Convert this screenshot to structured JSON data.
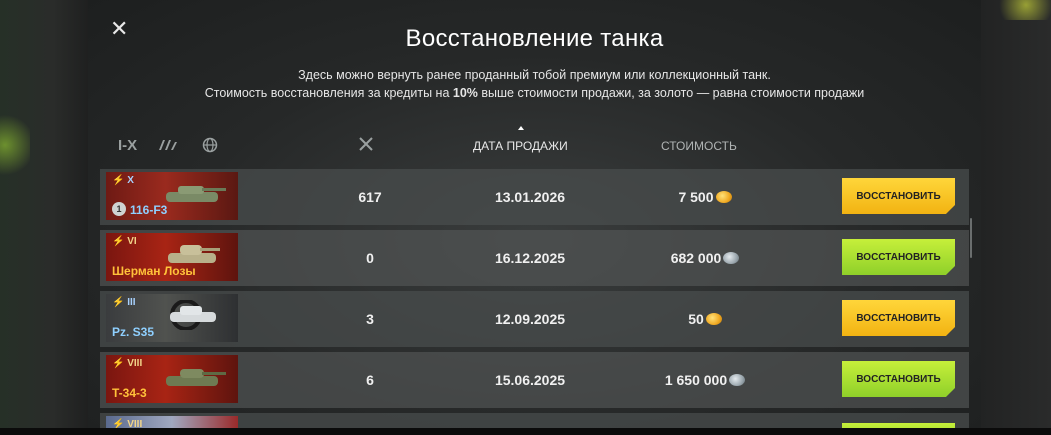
{
  "dialog": {
    "close_icon": "close-icon",
    "title": "Восстановление танка",
    "subtitle_line1": "Здесь можно вернуть ранее проданный тобой премиум или коллекционный танк.",
    "subtitle_line2_pre": "Стоимость восстановления за кредиты на ",
    "subtitle_line2_bold": "10%",
    "subtitle_line2_post": " выше стоимости продажи, за золото — равна стоимости продажи"
  },
  "filters": {
    "tier_label": "I-X",
    "type_icon": "tank-type-filter-icon",
    "nation_icon": "globe-icon"
  },
  "columns": {
    "battles_icon": "crossed-swords-icon",
    "date": "ДАТА ПРОДАЖИ",
    "cost": "СТОИМОСТЬ"
  },
  "colors": {
    "gold_button": "#f2b312",
    "green_button": "#8fd02a",
    "panel_bg": "#262828"
  },
  "rows": [
    {
      "tier": "X",
      "name": "116-F3",
      "battles": "617",
      "date": "13.01.2026",
      "cost": "7 500",
      "currency": "gold",
      "button": "ВОССТАНОВИТЬ"
    },
    {
      "tier": "VI",
      "name": "Шерман Лозы",
      "battles": "0",
      "date": "16.12.2025",
      "cost": "682 000",
      "currency": "silver",
      "button": "ВОССТАНОВИТЬ"
    },
    {
      "tier": "III",
      "name": "Pz. S35",
      "battles": "3",
      "date": "12.09.2025",
      "cost": "50",
      "currency": "gold",
      "button": "ВОССТАНОВИТЬ"
    },
    {
      "tier": "VIII",
      "name": "T-34-3",
      "battles": "6",
      "date": "15.06.2025",
      "cost": "1 650 000",
      "currency": "silver",
      "button": "ВОССТАНОВИТЬ"
    },
    {
      "tier": "VIII",
      "name": "",
      "battles": "",
      "date": "",
      "cost": "",
      "currency": "",
      "button": ""
    }
  ]
}
